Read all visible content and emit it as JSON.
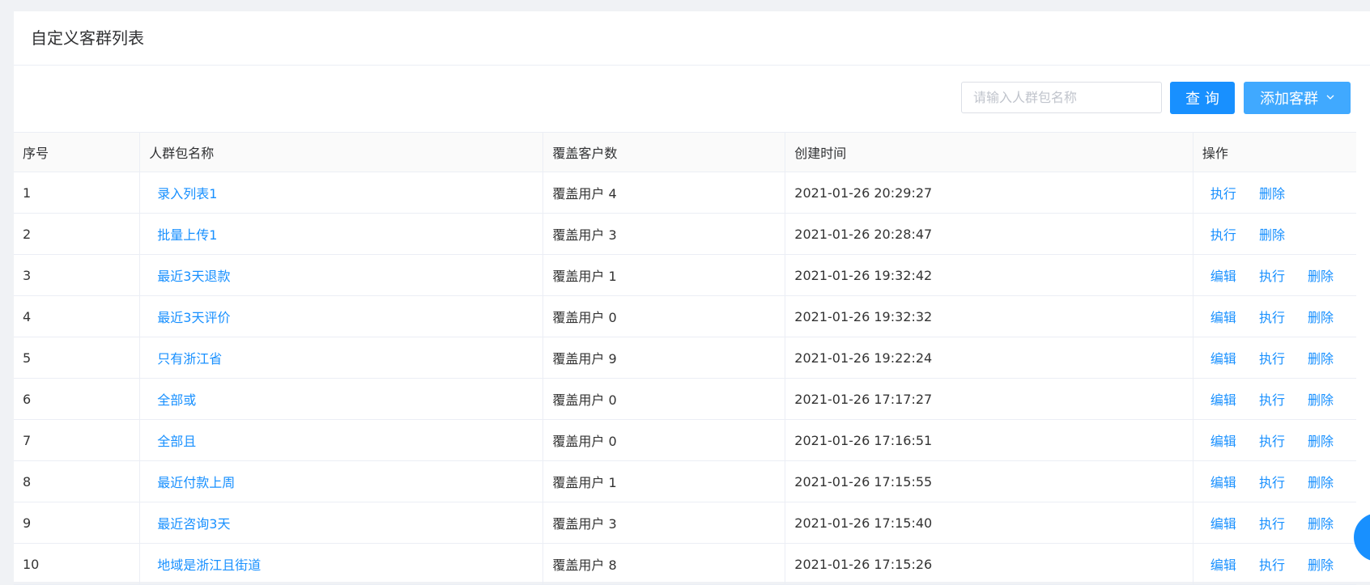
{
  "header": {
    "title": "自定义客群列表"
  },
  "toolbar": {
    "search_placeholder": "请输入人群包名称",
    "query_label": "查 询",
    "add_label": "添加客群"
  },
  "table": {
    "columns": [
      "序号",
      "人群包名称",
      "覆盖客户数",
      "创建时间",
      "操作"
    ],
    "rows": [
      {
        "seq": "1",
        "name": "录入列表1",
        "count": "覆盖用户 4",
        "time": "2021-01-26 20:29:27",
        "ops": [
          "执行",
          "删除"
        ]
      },
      {
        "seq": "2",
        "name": "批量上传1",
        "count": "覆盖用户 3",
        "time": "2021-01-26 20:28:47",
        "ops": [
          "执行",
          "删除"
        ]
      },
      {
        "seq": "3",
        "name": "最近3天退款",
        "count": "覆盖用户 1",
        "time": "2021-01-26 19:32:42",
        "ops": [
          "编辑",
          "执行",
          "删除"
        ]
      },
      {
        "seq": "4",
        "name": "最近3天评价",
        "count": "覆盖用户 0",
        "time": "2021-01-26 19:32:32",
        "ops": [
          "编辑",
          "执行",
          "删除"
        ]
      },
      {
        "seq": "5",
        "name": "只有浙江省",
        "count": "覆盖用户 9",
        "time": "2021-01-26 19:22:24",
        "ops": [
          "编辑",
          "执行",
          "删除"
        ]
      },
      {
        "seq": "6",
        "name": "全部或",
        "count": "覆盖用户 0",
        "time": "2021-01-26 17:17:27",
        "ops": [
          "编辑",
          "执行",
          "删除"
        ]
      },
      {
        "seq": "7",
        "name": "全部且",
        "count": "覆盖用户 0",
        "time": "2021-01-26 17:16:51",
        "ops": [
          "编辑",
          "执行",
          "删除"
        ]
      },
      {
        "seq": "8",
        "name": "最近付款上周",
        "count": "覆盖用户 1",
        "time": "2021-01-26 17:15:55",
        "ops": [
          "编辑",
          "执行",
          "删除"
        ]
      },
      {
        "seq": "9",
        "name": "最近咨询3天",
        "count": "覆盖用户 3",
        "time": "2021-01-26 17:15:40",
        "ops": [
          "编辑",
          "执行",
          "删除"
        ]
      },
      {
        "seq": "10",
        "name": "地域是浙江且街道",
        "count": "覆盖用户 8",
        "time": "2021-01-26 17:15:26",
        "ops": [
          "编辑",
          "执行",
          "删除"
        ]
      }
    ]
  },
  "colors": {
    "accent": "#1890ff",
    "accent_light": "#40a9ff",
    "border": "#ebeef5",
    "page_bg": "#f0f2f5"
  },
  "icons": {
    "add_dropdown": "chevron-down-icon"
  }
}
